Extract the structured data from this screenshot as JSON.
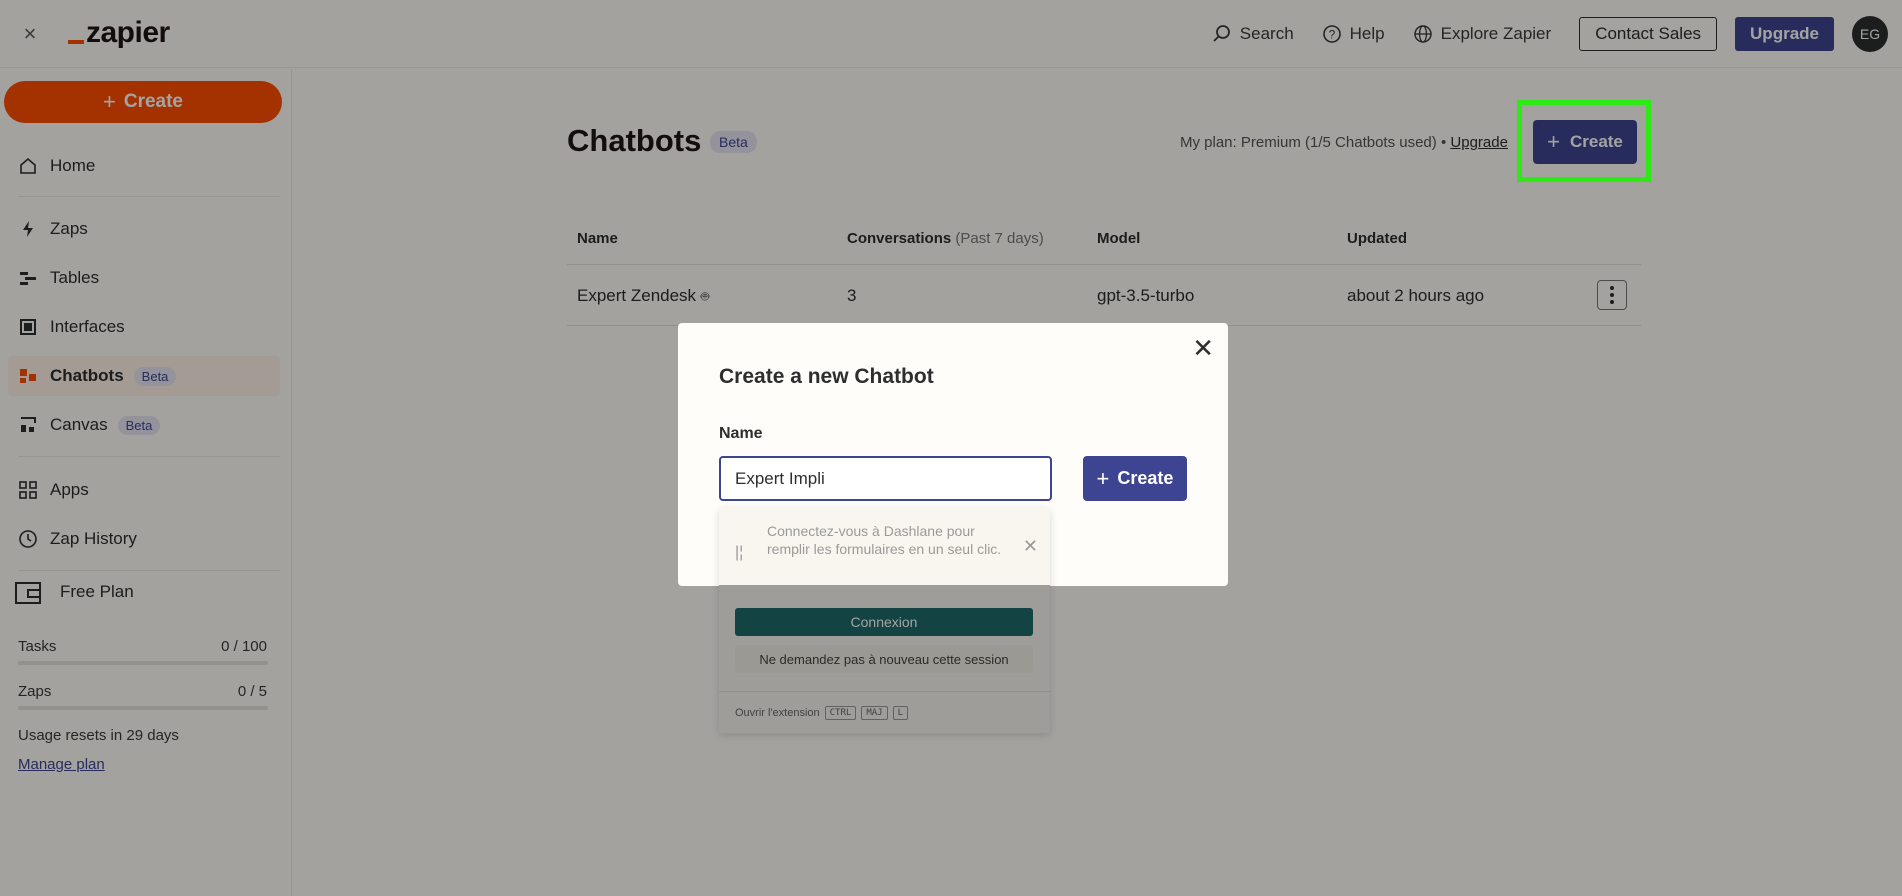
{
  "topbar": {
    "logo": "zapier",
    "search": "Search",
    "help": "Help",
    "explore": "Explore Zapier",
    "contact_sales": "Contact Sales",
    "upgrade": "Upgrade",
    "avatar_initials": "EG"
  },
  "sidebar": {
    "create_label": "Create",
    "items": [
      {
        "label": "Home",
        "icon": "home-icon"
      },
      {
        "label": "Zaps",
        "icon": "bolt-icon"
      },
      {
        "label": "Tables",
        "icon": "tables-icon"
      },
      {
        "label": "Interfaces",
        "icon": "interfaces-icon"
      },
      {
        "label": "Chatbots",
        "icon": "chatbot-icon",
        "badge": "Beta",
        "active": true
      },
      {
        "label": "Canvas",
        "icon": "canvas-icon",
        "badge": "Beta"
      },
      {
        "label": "Apps",
        "icon": "apps-icon"
      },
      {
        "label": "Zap History",
        "icon": "history-icon"
      }
    ],
    "plan_name": "Free Plan",
    "usage": [
      {
        "label": "Tasks",
        "value": "0 / 100",
        "fraction": 0
      },
      {
        "label": "Zaps",
        "value": "0 / 5",
        "fraction": 0
      }
    ],
    "resets": "Usage resets in 29 days",
    "manage_plan": "Manage plan"
  },
  "main": {
    "title": "Chatbots",
    "title_badge": "Beta",
    "plan_info": "My plan: Premium (1/5 Chatbots used)",
    "plan_sep": "•",
    "plan_upgrade": "Upgrade",
    "create_label": "Create",
    "columns": {
      "name": "Name",
      "conversations": "Conversations",
      "conversations_sub": "(Past 7 days)",
      "model": "Model",
      "updated": "Updated"
    },
    "rows": [
      {
        "name": "Expert Zendesk",
        "conversations": "3",
        "model": "gpt-3.5-turbo",
        "updated": "about 2 hours ago"
      }
    ]
  },
  "modal": {
    "title": "Create a new Chatbot",
    "field_label": "Name",
    "input_value": "Expert Impli",
    "create_label": "Create",
    "close": "✕"
  },
  "dashlane": {
    "message": "Connectez-vous à Dashlane pour remplir les formulaires en un seul clic.",
    "connect": "Connexion",
    "dont_ask": "Ne demandez pas à nouveau cette session",
    "open_ext": "Ouvrir l'extension",
    "keys": [
      "CTRL",
      "MAJ",
      "L"
    ]
  },
  "colors": {
    "brand_orange": "#ff4f00",
    "primary": "#3d4592",
    "highlight": "#2eea14"
  }
}
